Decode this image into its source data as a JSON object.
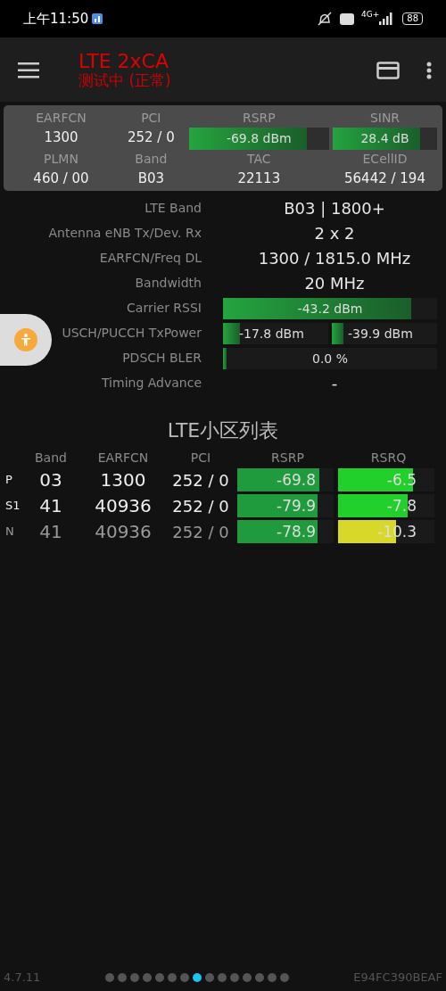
{
  "status_bar": {
    "time": "上午11:50",
    "network": "4G+",
    "battery": "88"
  },
  "app_bar": {
    "title": "LTE 2xCA",
    "subtitle": "测试中 (正常)"
  },
  "summary": {
    "row1": [
      {
        "label": "EARFCN",
        "value": "1300"
      },
      {
        "label": "PCI",
        "value": "252 / 0"
      },
      {
        "label": "RSRP",
        "value": "-69.8 dBm",
        "level": 0.84
      },
      {
        "label": "SINR",
        "value": "28.4 dB",
        "level": 0.84
      }
    ],
    "row2": [
      {
        "label": "PLMN",
        "value": "460 / 00"
      },
      {
        "label": "Band",
        "value": "B03"
      },
      {
        "label": "TAC",
        "value": "22113"
      },
      {
        "label": "ECellID",
        "value": "56442 / 194"
      }
    ]
  },
  "details": [
    {
      "kind": "text",
      "label": "LTE Band",
      "value": "B03 | 1800+"
    },
    {
      "kind": "text",
      "label": "Antenna eNB Tx/Dev. Rx",
      "value": "2 x 2"
    },
    {
      "kind": "text",
      "label": "EARFCN/Freq DL",
      "value": "1300 / 1815.0 MHz"
    },
    {
      "kind": "text",
      "label": "Bandwidth",
      "value": "20 MHz"
    },
    {
      "kind": "bar",
      "label": "Carrier RSSI",
      "bars": [
        {
          "value": "-43.2 dBm",
          "level": 0.88
        }
      ]
    },
    {
      "kind": "bar",
      "label": "USCH/PUCCH TxPower",
      "bars": [
        {
          "value": "-17.8 dBm",
          "level": 0.16
        },
        {
          "value": "-39.9 dBm",
          "level": 0.11
        }
      ]
    },
    {
      "kind": "bar",
      "label": "PDSCH BLER",
      "bars": [
        {
          "value": "0.0 %",
          "level": 0.015
        }
      ]
    },
    {
      "kind": "text",
      "label": "Timing Advance",
      "value": "-"
    }
  ],
  "cell_list": {
    "title": "LTE小区列表",
    "columns": [
      "Band",
      "EARFCN",
      "PCI",
      "RSRP",
      "RSRQ"
    ],
    "rows": [
      {
        "type": "P",
        "dimmed": false,
        "band": "03",
        "earfcn": "1300",
        "pci": "252 / 0",
        "rsrp": {
          "value": "-69.8",
          "level": 0.85,
          "color": "#1f9a3c"
        },
        "rsrq": {
          "value": "-6.5",
          "level": 0.78,
          "color": "#22d02c"
        }
      },
      {
        "type": "S1",
        "dimmed": false,
        "band": "41",
        "earfcn": "40936",
        "pci": "252 / 0",
        "rsrp": {
          "value": "-79.9",
          "level": 0.83,
          "color": "#1f9a3c"
        },
        "rsrq": {
          "value": "-7.8",
          "level": 0.72,
          "color": "#22d02c"
        }
      },
      {
        "type": "N",
        "dimmed": true,
        "band": "41",
        "earfcn": "40936",
        "pci": "252 / 0",
        "rsrp": {
          "value": "-78.9",
          "level": 0.83,
          "color": "#1f9a3c"
        },
        "rsrq": {
          "value": "-10.3",
          "level": 0.6,
          "color": "#d8d82a"
        }
      }
    ]
  },
  "footer": {
    "version": "4.7.11",
    "device_id": "E94FC390BEAF",
    "pages": [
      {
        "selected": false
      },
      {
        "selected": false
      },
      {
        "selected": false
      },
      {
        "selected": false
      },
      {
        "selected": false
      },
      {
        "selected": false
      },
      {
        "selected": false
      },
      {
        "selected": true
      },
      {
        "selected": false
      },
      {
        "selected": false
      },
      {
        "selected": false
      },
      {
        "selected": false
      },
      {
        "selected": false
      },
      {
        "selected": false
      },
      {
        "selected": false
      }
    ]
  }
}
